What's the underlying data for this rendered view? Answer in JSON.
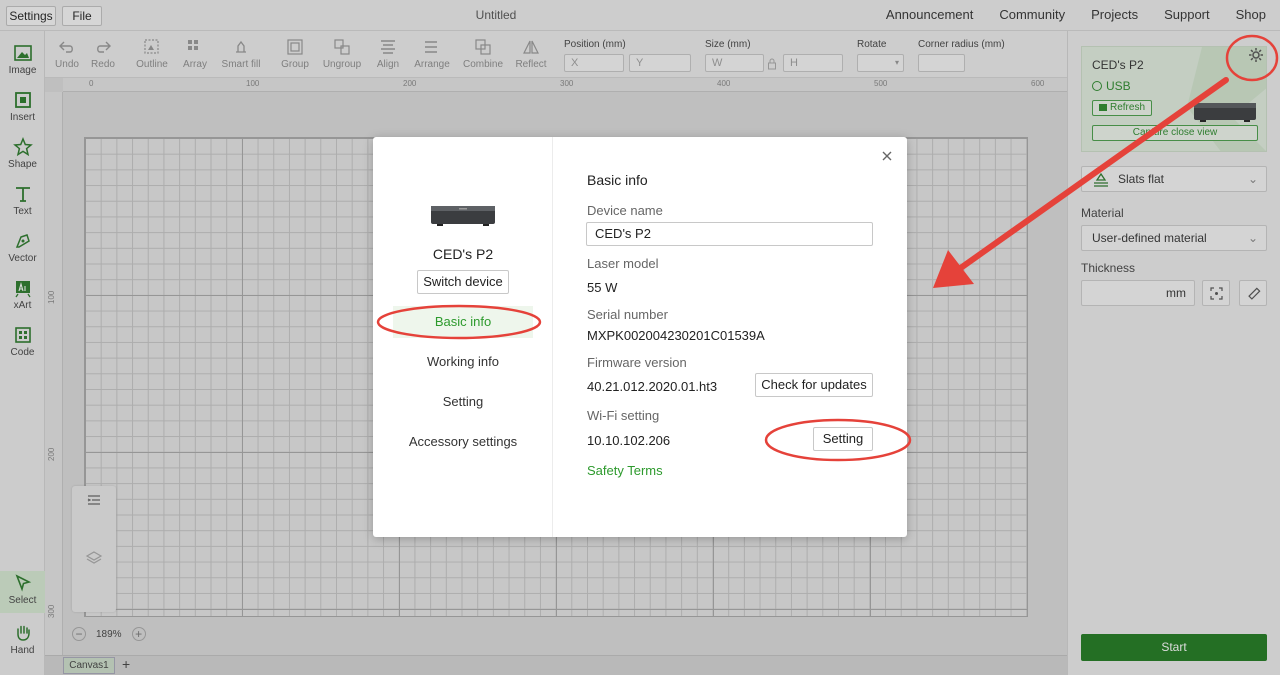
{
  "topbar": {
    "settings_label": "Settings",
    "file_label": "File",
    "doc_title": "Untitled",
    "nav": [
      "Announcement",
      "Community",
      "Projects",
      "Support",
      "Shop"
    ]
  },
  "left_tools": [
    "Image",
    "Insert",
    "Shape",
    "Text",
    "Vector",
    "xArt",
    "Code",
    "Select",
    "Hand"
  ],
  "toolbar": {
    "groups": [
      "Undo",
      "Redo",
      "Outline",
      "Array",
      "Smart fill",
      "Group",
      "Ungroup",
      "Align",
      "Arrange",
      "Combine",
      "Reflect"
    ],
    "position_label": "Position (mm)",
    "size_label": "Size (mm)",
    "rotate_label": "Rotate",
    "corner_label": "Corner radius (mm)",
    "x_placeholder": "X",
    "y_placeholder": "Y",
    "w_placeholder": "W",
    "h_placeholder": "H"
  },
  "ruler": {
    "top_ticks": [
      "0",
      "100",
      "200",
      "300",
      "400",
      "500",
      "600"
    ],
    "left_ticks": [
      "100",
      "200",
      "300"
    ]
  },
  "canvas": {
    "zoom_level": "189%",
    "tab_name": "Canvas1",
    "add_tab": "+"
  },
  "right_panel": {
    "device_name": "CED's P2",
    "connection": "USB",
    "refresh_label": "Refresh",
    "capture_label": "Capture close view",
    "base_select": "Slats flat",
    "material_label": "Material",
    "material_value": "User-defined material",
    "thickness_label": "Thickness",
    "thickness_unit": "mm",
    "start_label": "Start"
  },
  "modal": {
    "device_name": "CED's P2",
    "switch_device_label": "Switch device",
    "nav": [
      "Basic info",
      "Working info",
      "Setting",
      "Accessory settings"
    ],
    "section_title": "Basic info",
    "device_name_label": "Device name",
    "device_name_value": "CED's P2",
    "laser_model_label": "Laser model",
    "laser_model_value": "55 W",
    "serial_label": "Serial number",
    "serial_value": "MXPK002004230201C01539A",
    "firmware_label": "Firmware version",
    "firmware_value": "40.21.012.2020.01.ht3",
    "check_updates_label": "Check for updates",
    "wifi_label": "Wi-Fi setting",
    "wifi_value": "10.10.102.206",
    "wifi_setting_label": "Setting",
    "safety_terms_label": "Safety Terms"
  },
  "colors": {
    "accent_green": "#2d9a2d",
    "start_green": "#1f7a1f",
    "annotation_red": "#e5423a"
  }
}
